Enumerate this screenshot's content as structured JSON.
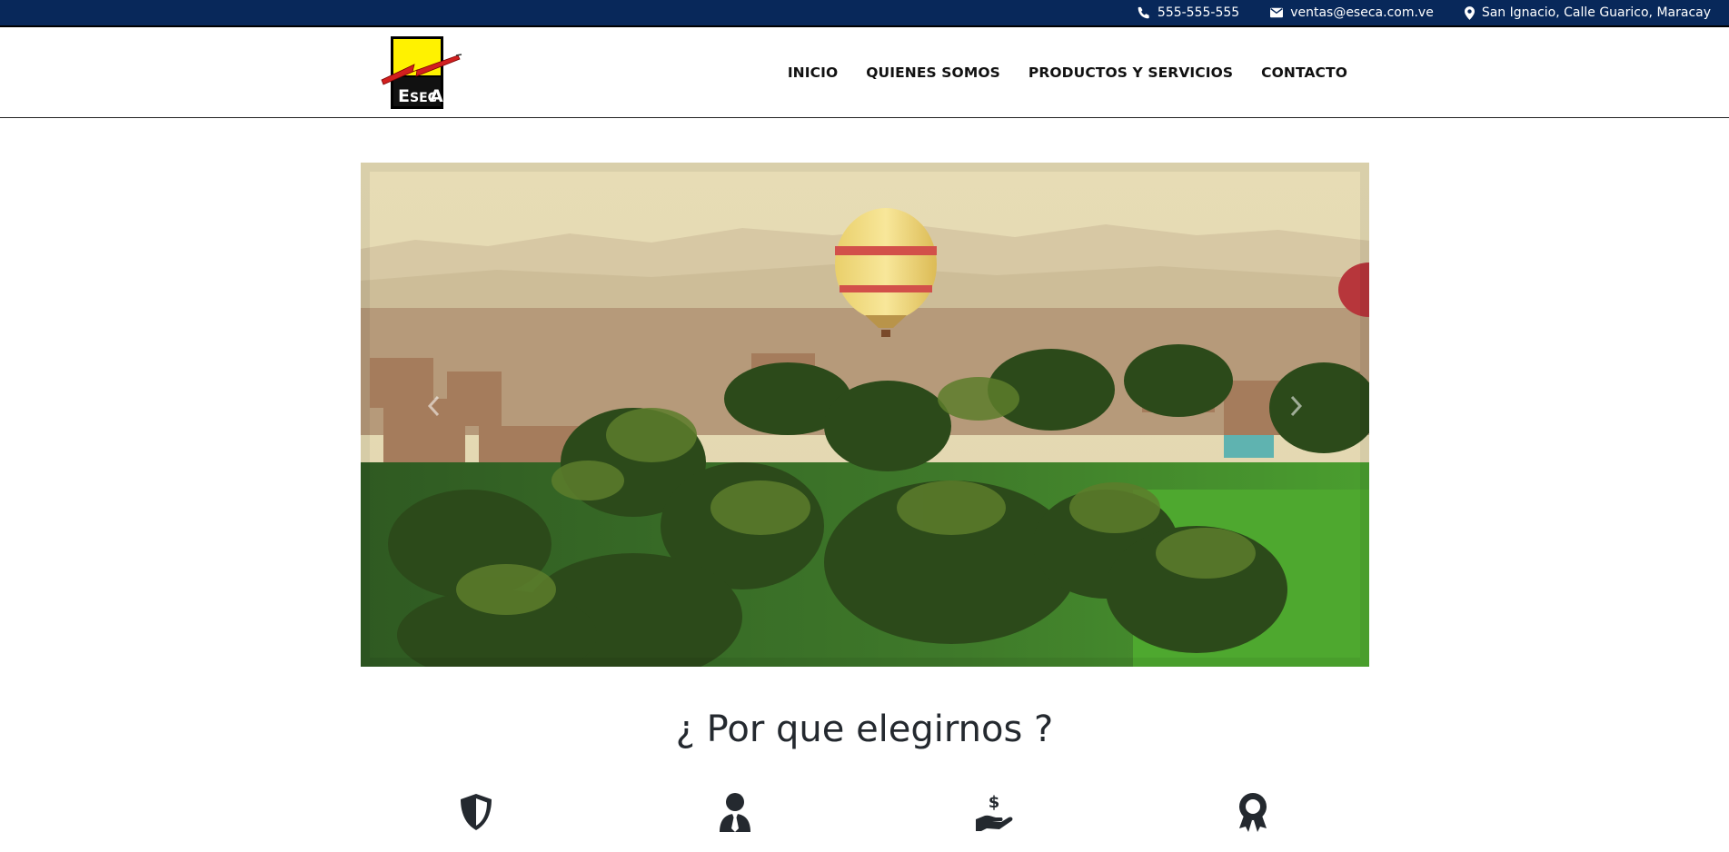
{
  "topbar": {
    "phone": "555-555-555",
    "email": "ventas@eseca.com.ve",
    "address": "San Ignacio, Calle Guarico, Maracay",
    "icons": [
      "phone-icon",
      "envelope-icon",
      "map-marker-icon"
    ]
  },
  "brand": {
    "logo_text": "ESECA",
    "colors": {
      "yellow": "#fff200",
      "red": "#d21f1f",
      "navy": "#08285a"
    }
  },
  "nav": {
    "items": [
      {
        "label": "INICIO"
      },
      {
        "label": "QUIENES SOMOS"
      },
      {
        "label": "PRODUCTOS Y SERVICIOS"
      },
      {
        "label": "CONTACTO"
      }
    ]
  },
  "carousel": {
    "slide_description_icons": [
      "chevron-left-icon",
      "chevron-right-icon"
    ]
  },
  "why": {
    "title": "¿ Por que elegirnos ?",
    "features": [
      {
        "icon": "shield-icon"
      },
      {
        "icon": "user-tie-icon"
      },
      {
        "icon": "hand-holding-dollar-icon"
      },
      {
        "icon": "award-ribbon-icon"
      }
    ]
  }
}
